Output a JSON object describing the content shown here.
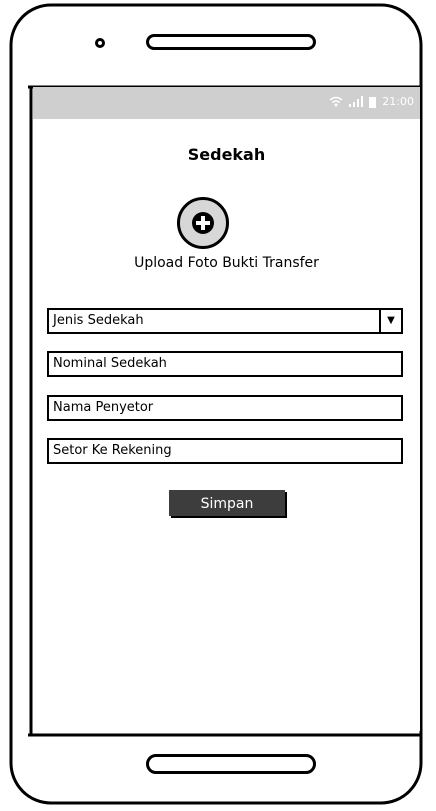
{
  "status_bar": {
    "time": "21:00",
    "wifi_icon": "wifi-icon",
    "signal_icon": "signal-icon",
    "battery_icon": "battery-icon"
  },
  "page": {
    "title": "Sedekah"
  },
  "upload": {
    "icon": "plus-circle-icon",
    "label": "Upload Foto Bukti Transfer"
  },
  "form": {
    "jenis_sedekah": {
      "value": "Jenis Sedekah",
      "icon": "chevron-down-icon"
    },
    "nominal_placeholder": "Nominal Sedekah",
    "nama_placeholder": "Nama Penyetor",
    "rekening_placeholder": "Setor Ke Rekening",
    "save_label": "Simpan"
  },
  "colors": {
    "status_bar": "#cfcfcf",
    "button": "#3d3d3d",
    "upload_circle": "#d7d7d7"
  }
}
